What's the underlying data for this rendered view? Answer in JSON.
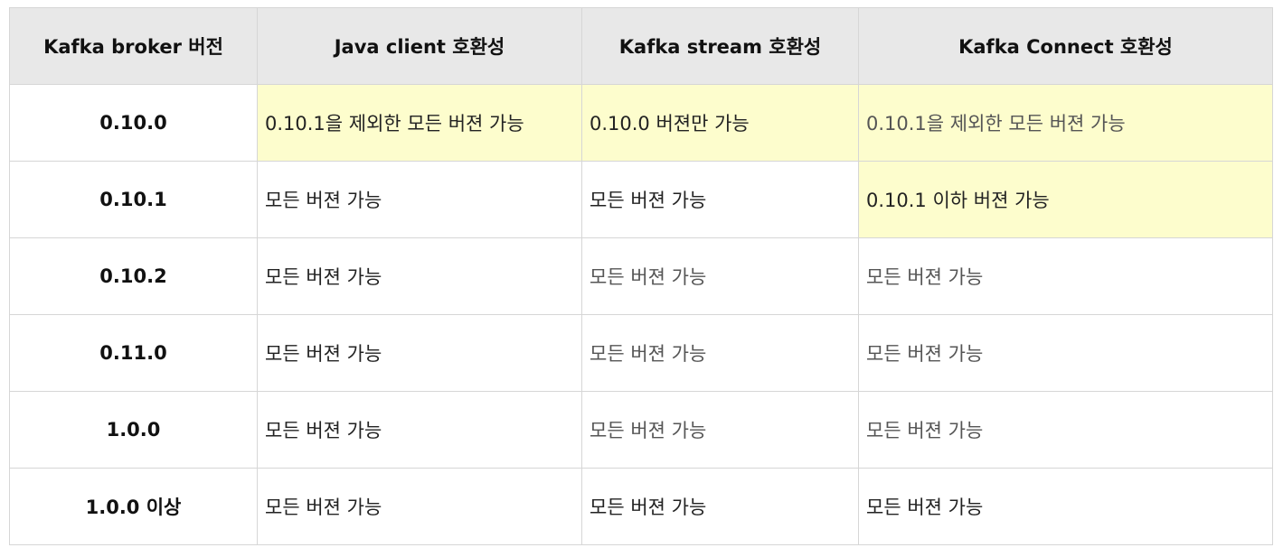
{
  "table": {
    "headers": [
      "Kafka broker 버전",
      "Java client 호환성",
      "Kafka stream 호환성",
      "Kafka Connect 호환성"
    ],
    "highlight_color": "#fdfdcd",
    "header_bg": "#e8e8e8",
    "rows": [
      {
        "broker": "0.10.0",
        "java_client": "0.10.1을 제외한 모든 버젼 가능",
        "kafka_stream": "0.10.0 버젼만 가능",
        "kafka_connect": "0.10.1을 제외한 모든 버젼 가능"
      },
      {
        "broker": "0.10.1",
        "java_client": "모든 버젼 가능",
        "kafka_stream": "모든 버젼 가능",
        "kafka_connect": "0.10.1 이하 버젼 가능"
      },
      {
        "broker": "0.10.2",
        "java_client": "모든 버젼 가능",
        "kafka_stream": "모든 버젼 가능",
        "kafka_connect": "모든 버젼 가능"
      },
      {
        "broker": "0.11.0",
        "java_client": "모든 버젼 가능",
        "kafka_stream": "모든 버젼 가능",
        "kafka_connect": "모든 버젼 가능"
      },
      {
        "broker": "1.0.0",
        "java_client": "모든 버젼 가능",
        "kafka_stream": "모든 버젼 가능",
        "kafka_connect": "모든 버젼 가능"
      },
      {
        "broker": "1.0.0 이상",
        "java_client": "모든 버젼 가능",
        "kafka_stream": "모든 버젼 가능",
        "kafka_connect": "모든 버젼 가능"
      }
    ]
  }
}
